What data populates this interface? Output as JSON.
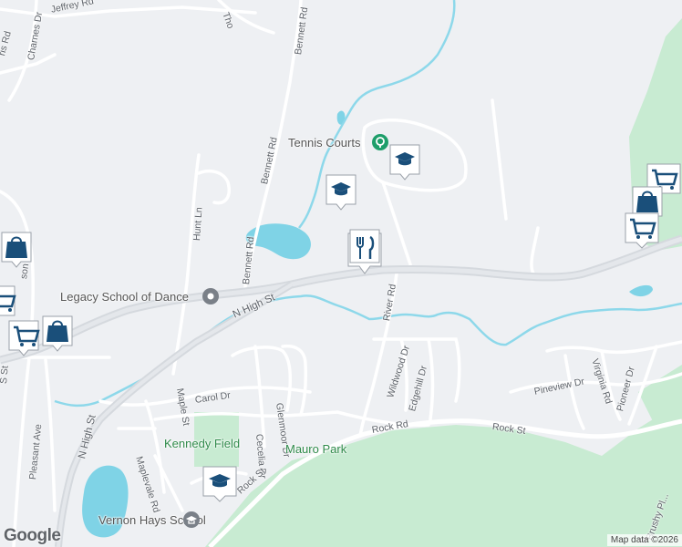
{
  "branding": {
    "logo_text": "Google"
  },
  "attribution": "Map data ©2026",
  "roads": {
    "jeffrey_rd": "Jeffrey Rd",
    "charnes_dr": "Charnes Dr",
    "bennett_rd": "Bennett Rd",
    "hunt_ln": "Hunt Ln",
    "n_high_st": "N High St",
    "river_rd": "River Rd",
    "maple_st": "Maple St",
    "carol_dr": "Carol Dr",
    "glenmoor_dr": "Glenmoor Dr",
    "cecelia_dr": "Cecelia Dr",
    "maplevale_rd": "Maplevale Rd",
    "pleasant_ave": "Pleasant Ave",
    "rock_st": "Rock St",
    "rock_rd": "Rock Rd",
    "wildwood_dr": "Wildwood Dr",
    "edgehill_dr": "Edgehill Dr",
    "pineview_dr": "Pineview Dr",
    "virginia_rd": "Virginia Rd",
    "pioneer_dr": "Pioneer Dr",
    "brushy_plain_rd": "Brushy Pl...",
    "son_st": "son St",
    "s_st": "S St",
    "ris_rd": "ris Rd",
    "thor_rd": "Tho",
    "b_rd": "B"
  },
  "places": {
    "tennis_courts": "Tennis Courts",
    "legacy_school": "Legacy School of Dance",
    "kennedy_field": "Kennedy Field",
    "mauro_park": "Mauro Park",
    "vernon_hays_school": "Vernon Hays School"
  },
  "markers": [
    {
      "type": "school",
      "icon": "graduation-cap-icon"
    },
    {
      "type": "school",
      "icon": "graduation-cap-icon"
    },
    {
      "type": "restaurant",
      "icon": "fork-knife-icon"
    },
    {
      "type": "shopping",
      "icon": "shopping-cart-icon"
    },
    {
      "type": "shopping",
      "icon": "shopping-bag-icon"
    },
    {
      "type": "shopping",
      "icon": "shopping-cart-icon"
    },
    {
      "type": "shopping",
      "icon": "shopping-bag-icon"
    },
    {
      "type": "shopping",
      "icon": "shopping-cart-icon"
    },
    {
      "type": "shopping",
      "icon": "shopping-cart-icon"
    },
    {
      "type": "shopping",
      "icon": "shopping-bag-icon"
    },
    {
      "type": "school",
      "icon": "graduation-cap-icon"
    }
  ],
  "colors": {
    "background": "#eef0f3",
    "park": "#c8ebd2",
    "water": "#7fd3e6",
    "road": "#ffffff",
    "highway": "#d9dde2",
    "marker": "#1a4f7a",
    "poi_green": "#1e9e6a",
    "poi_gray": "#7a8088"
  }
}
